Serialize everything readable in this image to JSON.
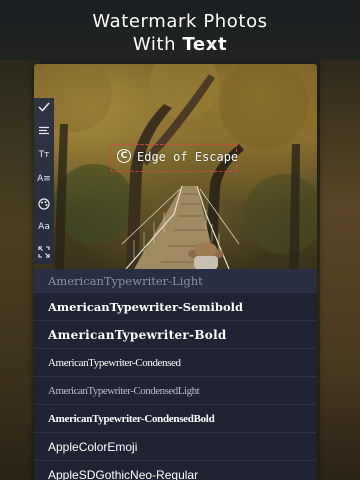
{
  "headline": {
    "line1": "Watermark Photos",
    "line2_prefix": "With ",
    "line2_bold": "Text"
  },
  "toolbar": {
    "items": [
      {
        "name": "check-icon"
      },
      {
        "name": "align-left-icon"
      },
      {
        "name": "text-size-icon",
        "glyph": "Tт"
      },
      {
        "name": "text-spacing-icon",
        "glyph": "A≡"
      },
      {
        "name": "color-palette-icon"
      },
      {
        "name": "font-icon",
        "glyph": "Aa"
      },
      {
        "name": "expand-icon"
      }
    ]
  },
  "watermark": {
    "symbol": "C",
    "text": "Edge of Escape"
  },
  "fonts": {
    "selected_header": "AmericanTypewriter-Light",
    "items": [
      "AmericanTypewriter-Semibold",
      "AmericanTypewriter-Bold",
      "AmericanTypewriter-Condensed",
      "AmericanTypewriter-CondensedLight",
      "AmericanTypewriter-CondensedBold",
      "AppleColorEmoji",
      "AppleSDGothicNeo-Regular"
    ]
  },
  "colors": {
    "toolbar_bg": "#262c42",
    "list_bg": "#1f2334",
    "watermark_border": "#dd4444",
    "text": "#ffffff"
  }
}
